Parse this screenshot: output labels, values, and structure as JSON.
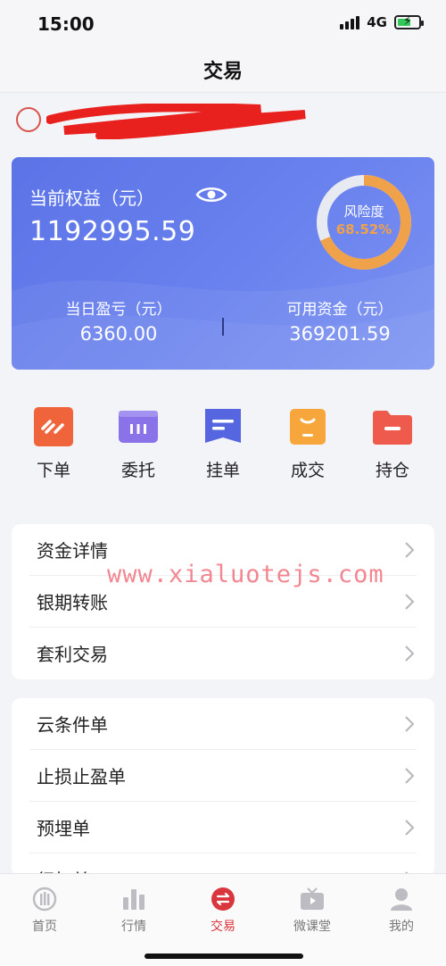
{
  "status_bar": {
    "time": "15:00",
    "network": "4G"
  },
  "nav": {
    "title": "交易"
  },
  "equity": {
    "label": "当前权益（元）",
    "value": "1192995.59",
    "risk_label": "风险度",
    "risk_value": "68.52%",
    "risk_fraction": 0.6852,
    "daily_pl_label": "当日盈亏（元）",
    "daily_pl_value": "6360.00",
    "available_label": "可用资金（元）",
    "available_value": "369201.59"
  },
  "actions": [
    {
      "label": "下单",
      "icon": "order-icon",
      "color": "#f0643c"
    },
    {
      "label": "委托",
      "icon": "entrust-icon",
      "color": "#8a72e8"
    },
    {
      "label": "挂单",
      "icon": "pending-order-icon",
      "color": "#5566e0"
    },
    {
      "label": "成交",
      "icon": "deal-icon",
      "color": "#f6a63a"
    },
    {
      "label": "持仓",
      "icon": "position-folder-icon",
      "color": "#ee5a4c"
    }
  ],
  "menu_group_1": [
    {
      "label": "资金详情"
    },
    {
      "label": "银期转账"
    },
    {
      "label": "套利交易"
    }
  ],
  "menu_group_2": [
    {
      "label": "云条件单"
    },
    {
      "label": "止损止盈单"
    },
    {
      "label": "预埋单"
    },
    {
      "label": "行权单"
    }
  ],
  "watermark": "www.xialuotejs.com",
  "tabs": [
    {
      "label": "首页",
      "icon": "home-icon",
      "active": false
    },
    {
      "label": "行情",
      "icon": "market-chart-icon",
      "active": false
    },
    {
      "label": "交易",
      "icon": "trade-swap-icon",
      "active": true
    },
    {
      "label": "微课堂",
      "icon": "tv-class-icon",
      "active": false
    },
    {
      "label": "我的",
      "icon": "user-icon",
      "active": false
    }
  ],
  "colors": {
    "card_gradient_start": "#5b73e6",
    "accent_red": "#d9363e",
    "risk_orange": "#f0a24a"
  }
}
